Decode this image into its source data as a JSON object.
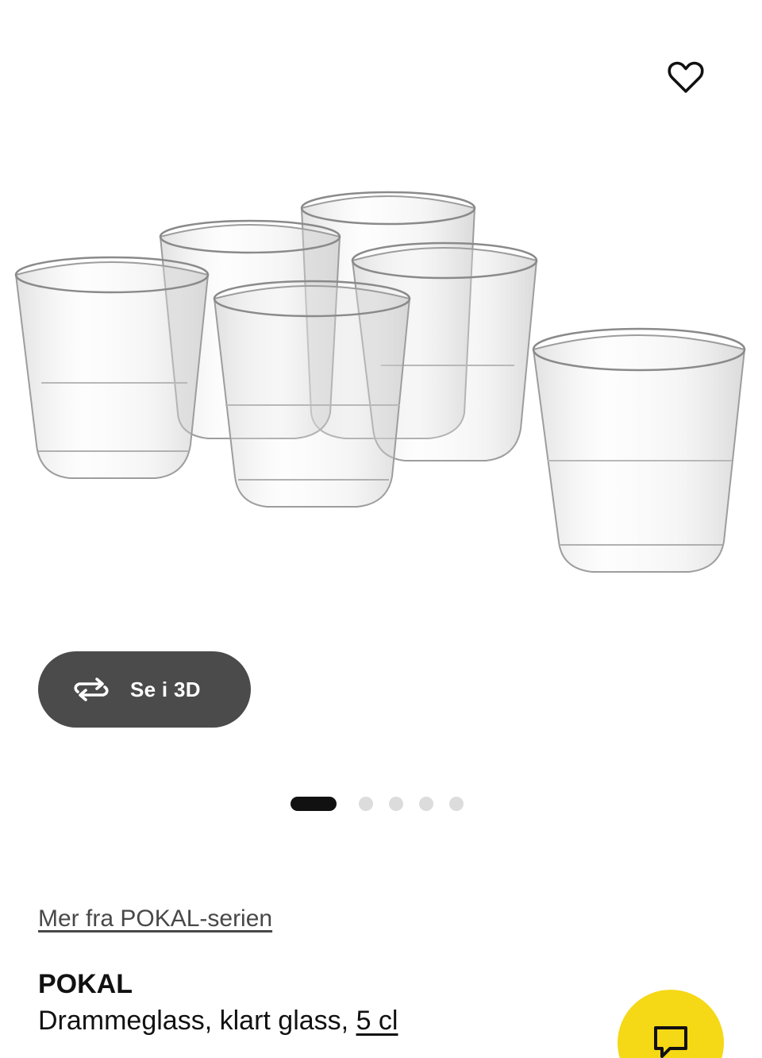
{
  "gallery": {
    "favorite_icon": "heart-outline-icon",
    "image_subject": "glass",
    "view3d": {
      "label": "Se i 3D",
      "icon": "rotate-3d-icon"
    },
    "pager": {
      "total": 5,
      "active_index": 0
    }
  },
  "product": {
    "series_link": "Mer fra POKAL-serien",
    "name": "POKAL",
    "description": "Drammeglass, klart glass,",
    "size_link": "5 cl"
  },
  "chat": {
    "icon": "chat-bubble-icon"
  },
  "colors": {
    "accent_yellow": "#f5d816",
    "dark_button": "#4b4b4b",
    "text": "#111111",
    "dot_inactive": "#dcdcdc"
  }
}
